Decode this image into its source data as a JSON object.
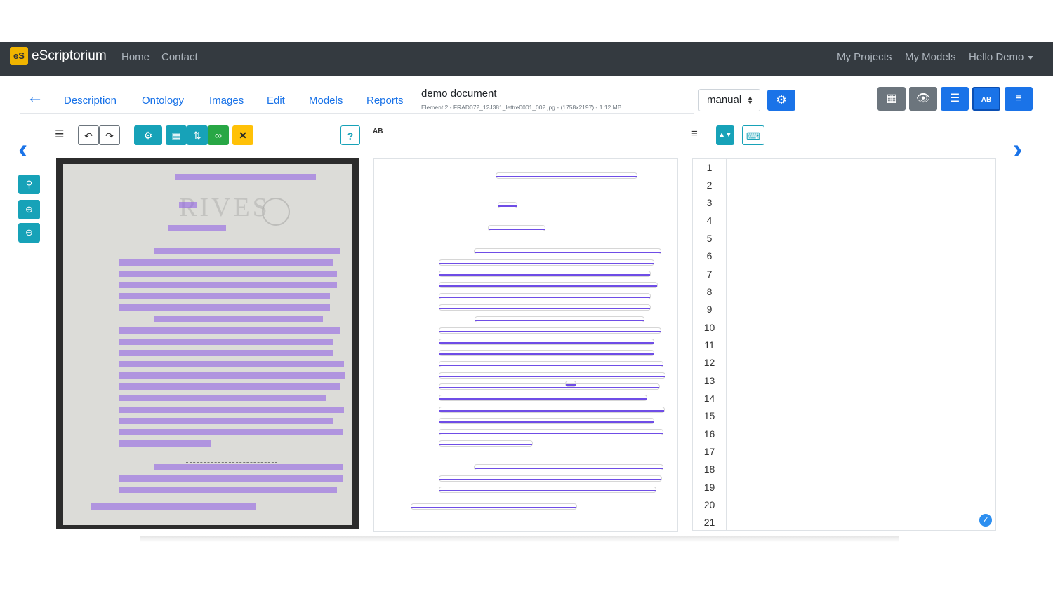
{
  "navbar": {
    "logo_text": "eS",
    "brand": "eScriptorium",
    "links": [
      "Home",
      "Contact"
    ],
    "right_links": [
      "My Projects",
      "My Models",
      "Hello Demo"
    ]
  },
  "tabs": [
    "Description",
    "Ontology",
    "Images",
    "Edit",
    "Models",
    "Reports"
  ],
  "document": {
    "title": "demo document",
    "meta": "Element 2 - FRAD072_12J381_lettre0001_002.jpg - (1758x2197) - 1.12 MB"
  },
  "transcription_select": {
    "value": "manual"
  },
  "image_panel": {
    "stamp_text": "RIVES"
  },
  "line_numbers": [
    "1",
    "2",
    "3",
    "4",
    "5",
    "6",
    "7",
    "8",
    "9",
    "10",
    "11",
    "12",
    "13",
    "14",
    "15",
    "16",
    "17",
    "18",
    "19",
    "20",
    "21"
  ],
  "colors": {
    "accent": "#1a73e8",
    "info": "#17a2b8",
    "success": "#28a745",
    "warning": "#ffc107",
    "secondary": "#6c757d",
    "navbar": "#343a40",
    "segment_line": "#6f4de6"
  }
}
